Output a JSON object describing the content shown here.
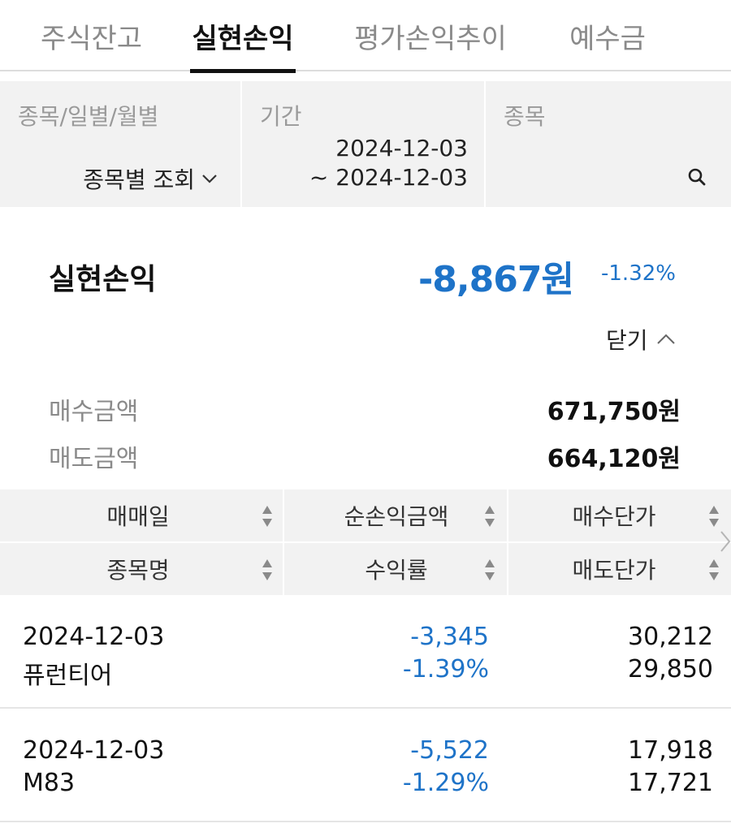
{
  "tabs": [
    {
      "label": "주식잔고",
      "active": false
    },
    {
      "label": "실현손익",
      "active": true
    },
    {
      "label": "평가손익추이",
      "active": false
    },
    {
      "label": "예수금",
      "active": false
    }
  ],
  "filter": {
    "type_label": "종목/일별/월별",
    "type_value": "종목별 조회",
    "period_label": "기간",
    "period_start": "2024-12-03",
    "period_end": "~ 2024-12-03",
    "stock_label": "종목"
  },
  "summary": {
    "label": "실현손익",
    "value": "-8,867원",
    "rate": "-1.32%",
    "close_label": "닫기",
    "buy_label": "매수금액",
    "buy_value": "671,750원",
    "sell_label": "매도금액",
    "sell_value": "664,120원"
  },
  "table": {
    "headers": [
      [
        "매매일",
        "순손익금액",
        "매수단가"
      ],
      [
        "종목명",
        "수익률",
        "매도단가"
      ]
    ],
    "rows": [
      {
        "date": "2024-12-03",
        "name": "퓨런티어",
        "pl": "-3,345",
        "rate": "-1.39%",
        "buy_price": "30,212",
        "sell_price": "29,850"
      },
      {
        "date": "2024-12-03",
        "name": "M83",
        "pl": "-5,522",
        "rate": "-1.29%",
        "buy_price": "17,918",
        "sell_price": "17,721"
      }
    ]
  },
  "colors": {
    "loss": "#1e73c8",
    "header_bg": "#f2f2f2"
  },
  "icons": [
    "search-icon",
    "chevron-down-icon",
    "chevron-up-icon",
    "sort-icon",
    "chevron-right-icon"
  ]
}
